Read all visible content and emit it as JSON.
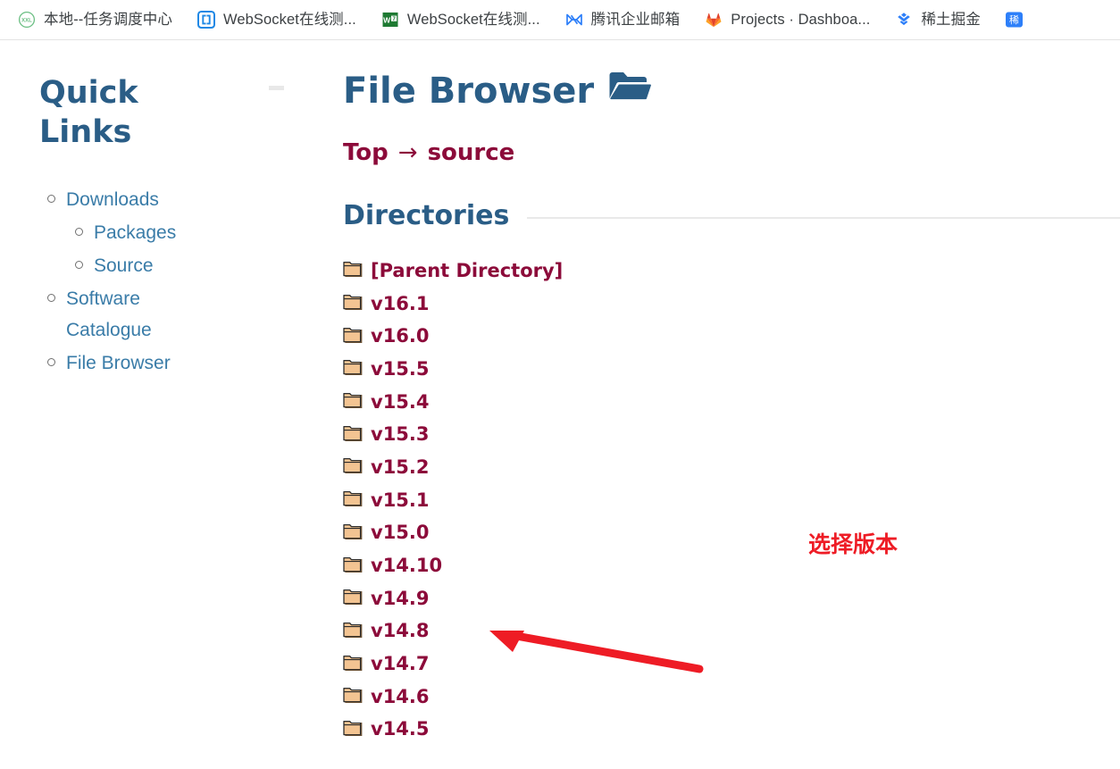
{
  "browser": {
    "bookmarks": [
      {
        "label": "本地--任务调度中心",
        "icon": "xxl-job-logo-icon"
      },
      {
        "label": "WebSocket在线测...",
        "icon": "websocket-brackets-icon"
      },
      {
        "label": "WebSocket在线测...",
        "icon": "websocket-green-icon"
      },
      {
        "label": "腾讯企业邮箱",
        "icon": "tencent-exmail-icon"
      },
      {
        "label": "Projects · Dashboa...",
        "icon": "gitlab-fox-icon"
      },
      {
        "label": "稀土掘金",
        "icon": "juejin-chevrons-icon"
      },
      {
        "label": "",
        "icon": "blue-bookmark-partial-icon"
      }
    ]
  },
  "sidebar": {
    "title": "Quick Links",
    "collapse_indicator": "collapse-dash",
    "items": [
      {
        "label": "Downloads",
        "level": 0
      },
      {
        "label": "Packages",
        "level": 1
      },
      {
        "label": "Source",
        "level": 1
      },
      {
        "label": "Software Catalogue",
        "level": 0
      },
      {
        "label": "File Browser",
        "level": 0
      }
    ]
  },
  "main": {
    "title": "File Browser",
    "title_icon": "open-folder-icon",
    "breadcrumb": {
      "items": [
        "Top",
        "source"
      ],
      "separator": "→"
    },
    "section": {
      "heading": "Directories"
    },
    "directories": [
      {
        "name": "[Parent Directory]",
        "icon": "folder-icon"
      },
      {
        "name": "v16.1",
        "icon": "folder-icon"
      },
      {
        "name": "v16.0",
        "icon": "folder-icon"
      },
      {
        "name": "v15.5",
        "icon": "folder-icon"
      },
      {
        "name": "v15.4",
        "icon": "folder-icon"
      },
      {
        "name": "v15.3",
        "icon": "folder-icon"
      },
      {
        "name": "v15.2",
        "icon": "folder-icon"
      },
      {
        "name": "v15.1",
        "icon": "folder-icon"
      },
      {
        "name": "v15.0",
        "icon": "folder-icon"
      },
      {
        "name": "v14.10",
        "icon": "folder-icon"
      },
      {
        "name": "v14.9",
        "icon": "folder-icon"
      },
      {
        "name": "v14.8",
        "icon": "folder-icon"
      },
      {
        "name": "v14.7",
        "icon": "folder-icon"
      },
      {
        "name": "v14.6",
        "icon": "folder-icon"
      },
      {
        "name": "v14.5",
        "icon": "folder-icon"
      }
    ]
  },
  "annotation": {
    "label": "选择版本",
    "arrow": "red-arrow-pointing-left",
    "color": "#ee1c25"
  },
  "colors": {
    "heading_blue": "#2a5d86",
    "link_blue": "#3a7ca8",
    "link_maroon": "#8c0b3a",
    "annotation_red": "#ee1c25",
    "folder_tan": "#f0c088",
    "rule_gray": "#e9e9e9"
  }
}
